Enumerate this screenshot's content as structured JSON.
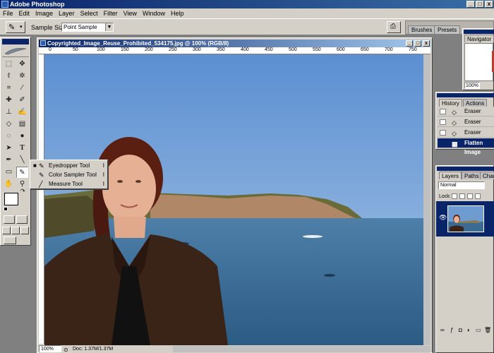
{
  "app": {
    "title": "Adobe Photoshop"
  },
  "menu": [
    "File",
    "Edit",
    "Image",
    "Layer",
    "Select",
    "Filter",
    "View",
    "Window",
    "Help"
  ],
  "options": {
    "sample_size_label": "Sample Size:",
    "sample_size_value": "Point Sample"
  },
  "palette_well": {
    "tabs": [
      "Brushes",
      "Presets"
    ]
  },
  "document": {
    "title": "Copyrighted_Image_Reuse_Prohibited_534175.jpg @ 100% (RGB/8)",
    "ruler_ticks": [
      "0",
      "50",
      "100",
      "150",
      "200",
      "250",
      "300",
      "350",
      "400",
      "450",
      "500",
      "550",
      "600",
      "650",
      "700",
      "750"
    ],
    "zoom": "100%",
    "doc_info": "Doc: 1.37M/1.37M"
  },
  "flyout": {
    "items": [
      {
        "label": "Eyedropper Tool",
        "shortcut": "I"
      },
      {
        "label": "Color Sampler Tool",
        "shortcut": "I"
      },
      {
        "label": "Measure Tool",
        "shortcut": "I"
      }
    ]
  },
  "navigator": {
    "title": "Navigator",
    "zoom": "100%"
  },
  "history": {
    "tabs": [
      "History",
      "Actions"
    ],
    "rows": [
      {
        "label": "Eraser",
        "selected": false
      },
      {
        "label": "Eraser",
        "selected": false
      },
      {
        "label": "Eraser",
        "selected": false
      },
      {
        "label": "Flatten Image",
        "selected": true
      }
    ]
  },
  "layers": {
    "tabs": [
      "Layers",
      "Paths",
      "Channels"
    ],
    "blend_mode": "Normal",
    "lock_label": "Lock:"
  },
  "colors": {
    "titlebar": "#0a246a",
    "chrome": "#d4d0c8",
    "workspace": "#808080"
  }
}
